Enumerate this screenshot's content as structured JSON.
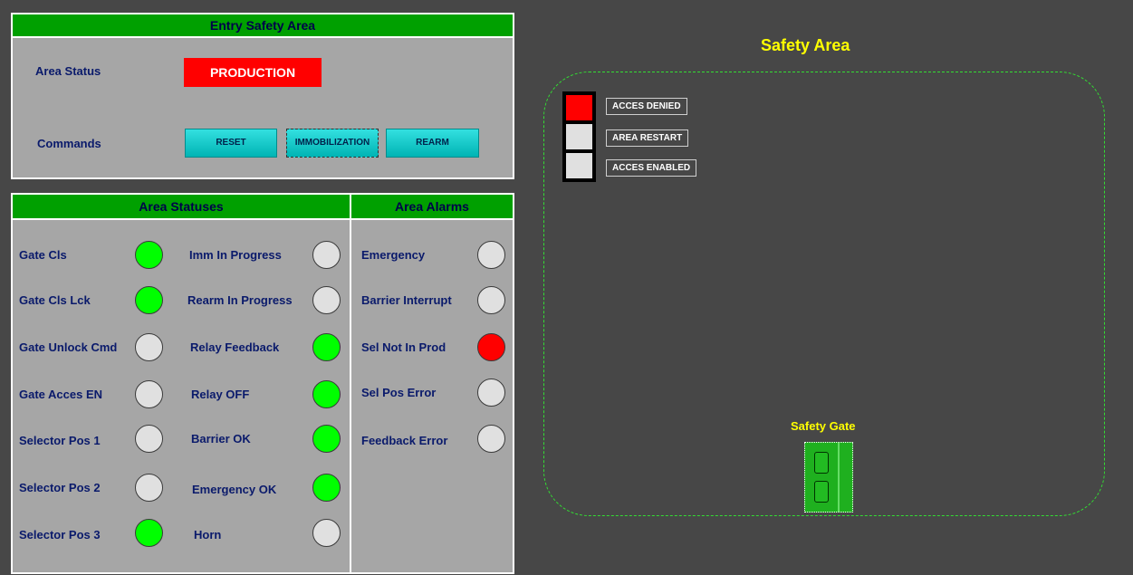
{
  "entry_panel": {
    "title": "Entry Safety Area",
    "area_status_label": "Area Status",
    "area_status_value": "PRODUCTION",
    "commands_label": "Commands",
    "buttons": {
      "reset": "RESET",
      "immobilization": "IMMOBILIZATION",
      "rearm": "REARM"
    }
  },
  "statuses_panel": {
    "title": "Area Statuses",
    "col1": [
      {
        "label": "Gate Cls",
        "state": "on"
      },
      {
        "label": "Gate Cls Lck",
        "state": "on"
      },
      {
        "label": "Gate Unlock Cmd",
        "state": "off"
      },
      {
        "label": "Gate Acces EN",
        "state": "off"
      },
      {
        "label": "Selector Pos 1",
        "state": "off"
      },
      {
        "label": "Selector Pos 2",
        "state": "off"
      },
      {
        "label": "Selector Pos 3",
        "state": "on"
      }
    ],
    "col2": [
      {
        "label": "Imm In Progress",
        "state": "off"
      },
      {
        "label": "Rearm In Progress",
        "state": "off"
      },
      {
        "label": "Relay Feedback",
        "state": "on"
      },
      {
        "label": "Relay OFF",
        "state": "on"
      },
      {
        "label": "Barrier OK",
        "state": "on"
      },
      {
        "label": "Emergency OK",
        "state": "on"
      },
      {
        "label": "Horn",
        "state": "off"
      }
    ]
  },
  "alarms_panel": {
    "title": "Area Alarms",
    "items": [
      {
        "label": "Emergency",
        "state": "off"
      },
      {
        "label": "Barrier Interrupt",
        "state": "off"
      },
      {
        "label": "Sel Not In Prod",
        "state": "alarm"
      },
      {
        "label": "Sel Pos Error",
        "state": "off"
      },
      {
        "label": "Feedback Error",
        "state": "off"
      }
    ]
  },
  "safety_area": {
    "title": "Safety Area",
    "indicators": [
      {
        "label": "ACCES DENIED",
        "color": "#ff0000"
      },
      {
        "label": "AREA RESTART",
        "color": "#e0e0e0"
      },
      {
        "label": "ACCES ENABLED",
        "color": "#e0e0e0"
      }
    ],
    "gate_title": "Safety Gate"
  },
  "colors": {
    "accent_green": "#00a000",
    "lamp_on": "#00ff00",
    "lamp_alarm": "#ff0000",
    "lamp_off": "#e0e0e0"
  }
}
